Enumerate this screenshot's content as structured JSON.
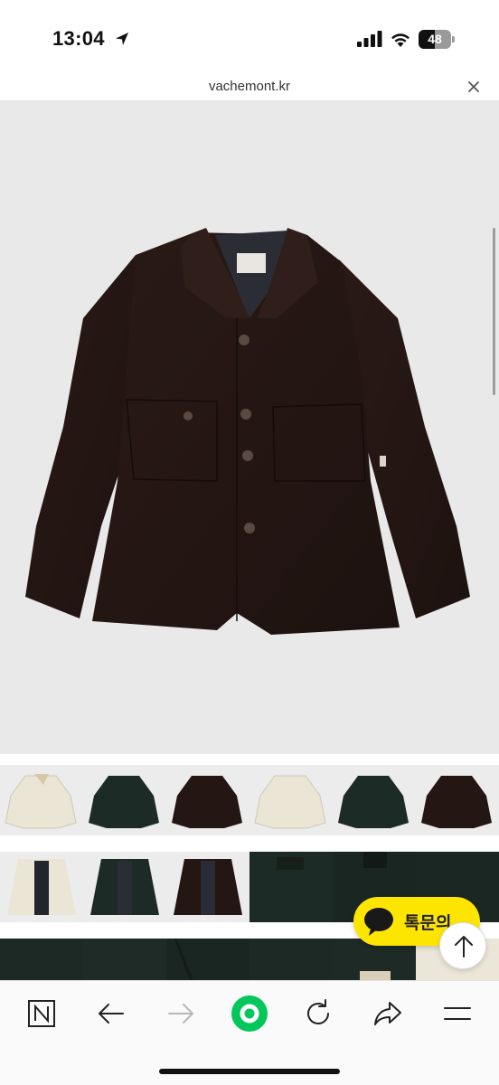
{
  "status_bar": {
    "time": "13:04",
    "battery_level": "48",
    "icons": [
      "location-arrow-icon",
      "cellular-signal-icon",
      "wifi-icon",
      "battery-icon"
    ]
  },
  "browser": {
    "url": "vachemont.kr",
    "close_icon": "close-icon"
  },
  "product": {
    "main_image": "dark-brown-work-jacket",
    "thumbnails": [
      {
        "row": 1,
        "col": 1,
        "color": "cream"
      },
      {
        "row": 1,
        "col": 2,
        "color": "dark-green"
      },
      {
        "row": 1,
        "col": 3,
        "color": "dark-brown"
      },
      {
        "row": 1,
        "col": 4,
        "color": "cream"
      },
      {
        "row": 1,
        "col": 5,
        "color": "dark-green"
      },
      {
        "row": 1,
        "col": 6,
        "color": "dark-brown"
      },
      {
        "row": 2,
        "col": 1,
        "color": "cream-open"
      },
      {
        "row": 2,
        "col": 2,
        "color": "green-open"
      },
      {
        "row": 2,
        "col": 3,
        "color": "brown-open"
      },
      {
        "row": 2,
        "col": 4,
        "color": "green-detail"
      },
      {
        "row": 2,
        "col": 5,
        "color": "green-detail"
      },
      {
        "row": 2,
        "col": 6,
        "color": "green-detail"
      },
      {
        "row": 3,
        "col": 1,
        "color": "green-detail"
      },
      {
        "row": 3,
        "col": 2,
        "color": "green-detail"
      },
      {
        "row": 3,
        "col": 3,
        "color": "green-detail"
      },
      {
        "row": 3,
        "col": 4,
        "color": "green-detail"
      },
      {
        "row": 3,
        "col": 5,
        "color": "green-collar"
      },
      {
        "row": 3,
        "col": 6,
        "color": "cream-detail"
      }
    ]
  },
  "chat": {
    "label": "톡문의",
    "brand_color": "#FEE500"
  },
  "toolbar": {
    "items": [
      "naver-n-icon",
      "back-arrow-icon",
      "forward-arrow-icon",
      "green-circle-icon",
      "refresh-icon",
      "share-icon",
      "menu-icon"
    ],
    "accent": "#03C75A"
  }
}
